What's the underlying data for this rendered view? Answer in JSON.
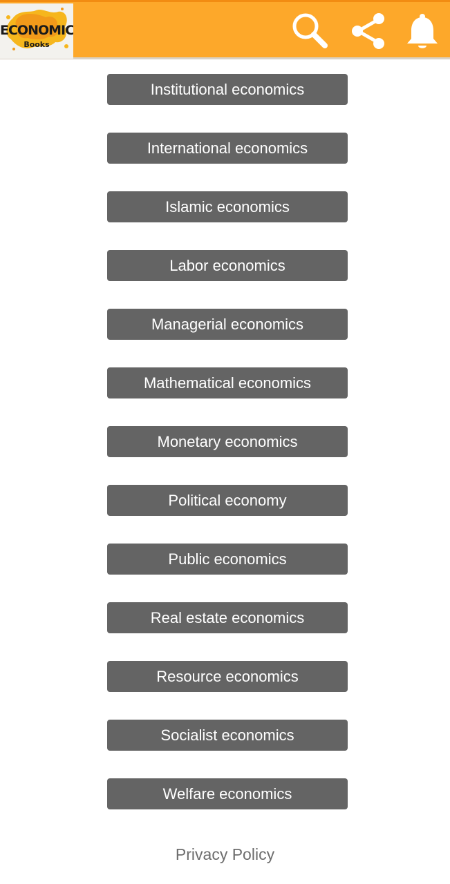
{
  "header": {
    "logo_title": "ECONOMICS",
    "logo_subtitle": "Books",
    "icons": [
      "search-icon",
      "share-icon",
      "bell-icon"
    ],
    "background_color": "#fda82a"
  },
  "topics": [
    "Institutional economics",
    "International economics",
    "Islamic economics",
    "Labor economics",
    "Managerial economics",
    "Mathematical economics",
    "Monetary economics",
    "Political economy",
    "Public economics",
    "Real estate economics",
    "Resource economics",
    "Socialist economics",
    "Welfare economics"
  ],
  "footer": {
    "privacy_label": "Privacy Policy"
  },
  "colors": {
    "button": "#646464",
    "button_text": "#ffffff",
    "link": "#6d6d6d"
  }
}
